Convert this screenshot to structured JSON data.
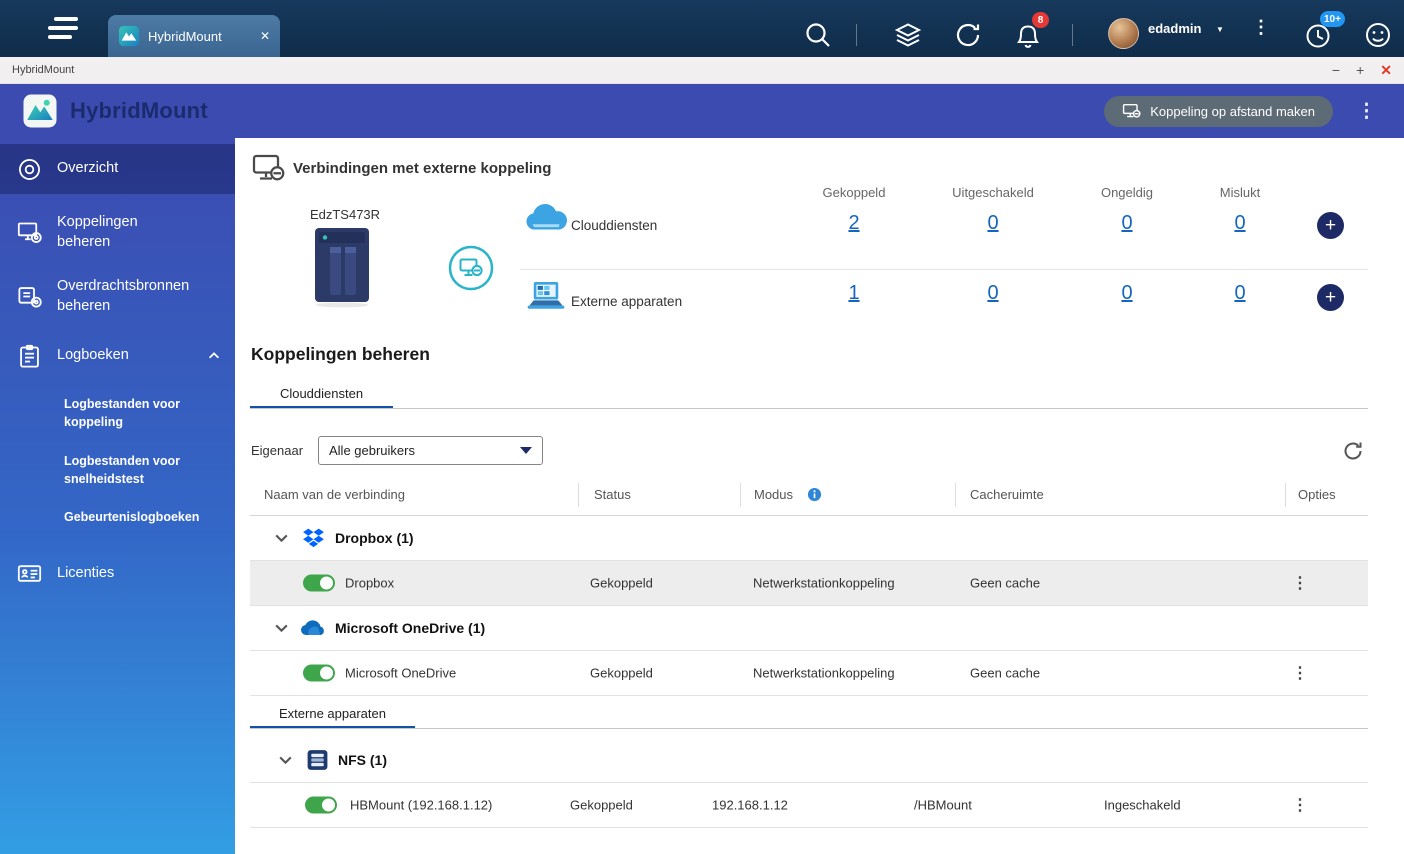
{
  "colors": {
    "accent": "#1565c0",
    "toggle_on": "#3fa54a",
    "badge_red": "#e53935",
    "badge_blue": "#2196f3",
    "sidebar_top": "#3c4bb0",
    "sidebar_bottom": "#339ee4"
  },
  "icons": {
    "kebab": "⋮",
    "close": "✕",
    "minimize": "−",
    "maximize": "+",
    "caret_down": "▼",
    "plus": "+"
  },
  "topbar": {
    "tab_title": "HybridMount",
    "username": "edadmin",
    "notification_count": "8",
    "tasks_count": "10+"
  },
  "window": {
    "title": "HybridMount"
  },
  "header": {
    "app_title": "HybridMount",
    "remote_mount_button": "Koppeling op afstand maken"
  },
  "sidebar": {
    "items": [
      {
        "label": "Overzicht"
      },
      {
        "label": "Koppelingen beheren"
      },
      {
        "label": "Overdrachtsbronnen beheren"
      },
      {
        "label": "Logboeken"
      },
      {
        "label": "Licenties"
      }
    ],
    "log_subitems": [
      {
        "label": "Logbestanden voor koppeling"
      },
      {
        "label": "Logbestanden voor snelheidstest"
      },
      {
        "label": "Gebeurtenislogboeken"
      }
    ]
  },
  "overview": {
    "title": "Verbindingen met externe koppeling",
    "nas_name": "EdzTS473R",
    "columns": [
      "Gekoppeld",
      "Uitgeschakeld",
      "Ongeldig",
      "Mislukt"
    ],
    "rows": [
      {
        "label": "Clouddiensten",
        "values": [
          "2",
          "0",
          "0",
          "0"
        ]
      },
      {
        "label": "Externe apparaten",
        "values": [
          "1",
          "0",
          "0",
          "0"
        ]
      }
    ]
  },
  "manage": {
    "title": "Koppelingen beheren",
    "tabs": {
      "cloud": "Clouddiensten",
      "external": "Externe apparaten"
    },
    "owner_label": "Eigenaar",
    "owner_value": "Alle gebruikers",
    "headers": {
      "name": "Naam van de verbinding",
      "status": "Status",
      "mode": "Modus",
      "cache": "Cacheruimte",
      "options": "Opties"
    },
    "cloud": {
      "groups": [
        {
          "label": "Dropbox (1)",
          "rows": [
            {
              "name": "Dropbox",
              "status": "Gekoppeld",
              "mode": "Netwerkstationkoppeling",
              "cache": "Geen cache"
            }
          ]
        },
        {
          "label": "Microsoft OneDrive (1)",
          "rows": [
            {
              "name": "Microsoft OneDrive",
              "status": "Gekoppeld",
              "mode": "Netwerkstationkoppeling",
              "cache": "Geen cache"
            }
          ]
        }
      ]
    },
    "external": {
      "groups": [
        {
          "label": "NFS (1)",
          "rows": [
            {
              "name": "HBMount (192.168.1.12)",
              "status": "Gekoppeld",
              "ip": "192.168.1.12",
              "path": "/HBMount",
              "state": "Ingeschakeld"
            }
          ]
        }
      ]
    }
  }
}
